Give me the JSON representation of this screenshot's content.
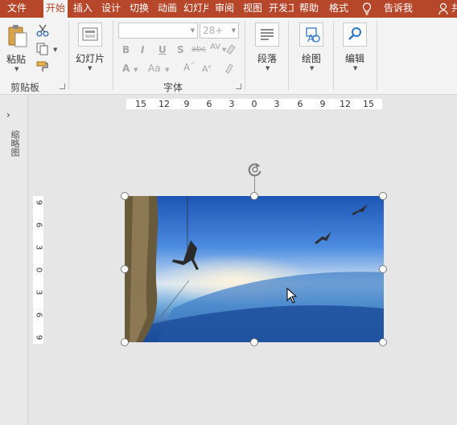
{
  "tabs": [
    {
      "label": "文件",
      "active": false
    },
    {
      "label": "开始",
      "active": true
    },
    {
      "label": "插入",
      "active": false
    },
    {
      "label": "设计",
      "active": false
    },
    {
      "label": "切换",
      "active": false
    },
    {
      "label": "动画",
      "active": false
    },
    {
      "label": "幻灯片放映",
      "active": false
    },
    {
      "label": "审阅",
      "active": false
    },
    {
      "label": "视图",
      "active": false
    },
    {
      "label": "开发工具",
      "active": false
    },
    {
      "label": "帮助",
      "active": false
    },
    {
      "label": "格式",
      "active": false
    }
  ],
  "tell_me": "告诉我",
  "share": "共享",
  "ribbon": {
    "clipboard": {
      "paste_label": "粘贴",
      "group_label": "剪贴板"
    },
    "slides": {
      "label": "幻灯片"
    },
    "font": {
      "group_label": "字体",
      "font_name": "",
      "font_size": "28+"
    },
    "paragraph": {
      "label": "段落"
    },
    "drawing": {
      "label": "绘图"
    },
    "editing": {
      "label": "编辑"
    }
  },
  "left_pane": {
    "label": "缩略图"
  },
  "ruler": {
    "horizontal": [
      "15",
      "12",
      "9",
      "6",
      "3",
      "0",
      "3",
      "6",
      "9",
      "12",
      "15"
    ],
    "vertical": [
      "9",
      "6",
      "3",
      "0",
      "3",
      "6",
      "9"
    ]
  },
  "colors": {
    "accent": "#b7472a",
    "ribbon_bg": "#f3f3f3",
    "canvas_bg": "#e6e6e6"
  }
}
